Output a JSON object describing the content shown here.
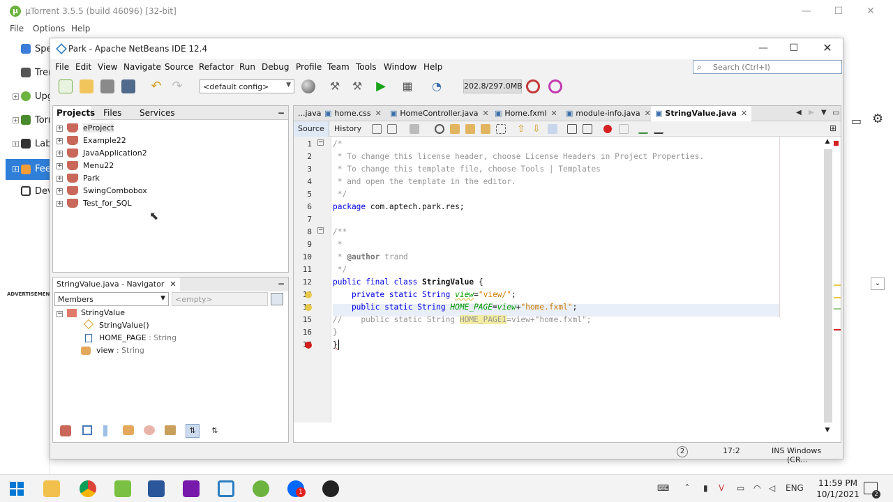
{
  "utorrent": {
    "title": "µTorrent 3.5.5  (build 46096) [32-bit]",
    "menu": [
      "File",
      "Options",
      "Help"
    ],
    "sidebar": [
      "Spe",
      "Trer",
      "Upg",
      "Torr",
      "Lab",
      "Fee",
      "Dev"
    ],
    "advertisement": "ADVERTISEMENT"
  },
  "netbeans": {
    "title": "Park - Apache NetBeans IDE 12.4",
    "menu": [
      "File",
      "Edit",
      "View",
      "Navigate",
      "Source",
      "Refactor",
      "Run",
      "Debug",
      "Profile",
      "Team",
      "Tools",
      "Window",
      "Help"
    ],
    "search_placeholder": "Search (Ctrl+I)",
    "config": "<default config>",
    "memory": "202.8/297.0MB",
    "projects_panel": {
      "tabs": [
        "Projects",
        "Files",
        "Services"
      ],
      "items": [
        "eProject",
        "Example22",
        "JavaApplication2",
        "Menu22",
        "Park",
        "SwingCombobox",
        "Test_for_SQL"
      ]
    },
    "navigator": {
      "title": "StringValue.java - Navigator",
      "filter": "Members",
      "filter2": "<empty>",
      "root": "StringValue",
      "members": [
        {
          "name": "StringValue()",
          "type": ""
        },
        {
          "name": "HOME_PAGE",
          "type": " : String"
        },
        {
          "name": "view",
          "type": " : String"
        }
      ]
    },
    "editor": {
      "tabs": [
        "...java",
        "home.css",
        "HomeController.java",
        "Home.fxml",
        "module-info.java",
        "StringValue.java"
      ],
      "view_tabs": [
        "Source",
        "History"
      ],
      "line_numbers": [
        "1",
        "2",
        "3",
        "4",
        "5",
        "6",
        "7",
        "8",
        "9",
        "10",
        "11",
        "12",
        "13",
        "14",
        "15",
        "16",
        "17"
      ],
      "code": {
        "l1": "/*",
        "l2": " * To change this license header, choose License Headers in Project Properties.",
        "l3": " * To change this template file, choose Tools | Templates",
        "l4": " * and open the template in the editor.",
        "l5": " */",
        "l6_kw": "package",
        "l6_rest": " com.aptech.park.res;",
        "l8": "/**",
        "l9": " *",
        "l10_a": " * ",
        "l10_tag": "@author",
        "l10_b": " trand",
        "l11": " */",
        "l12_kw": "public final class ",
        "l12_name": "StringValue",
        "l12_end": " {",
        "l13_kw": "    private static String ",
        "l13_field": "view",
        "l13_eq": "=",
        "l13_str": "\"view/\"",
        "l13_end": ";",
        "l14_kw": "    public static String ",
        "l14_field": "HOME_PAGE",
        "l14_eq": "=",
        "l14_field2": "view",
        "l14_plus": "+",
        "l14_str": "\"home.fxml\"",
        "l14_end": ";",
        "l15_a": "//    public static String ",
        "l15_hl": "HOME_PAGE1",
        "l15_b": "=view+\"home.fxml\";",
        "l16": "}",
        "l17": "}"
      }
    },
    "status": {
      "notifications": "2",
      "position": "17:2",
      "mode": "INS",
      "line_ending": "Windows (CR..."
    }
  },
  "taskbar": {
    "time": "11:59 PM",
    "date": "10/1/2021",
    "lang": "ENG",
    "notif_count": "2"
  }
}
